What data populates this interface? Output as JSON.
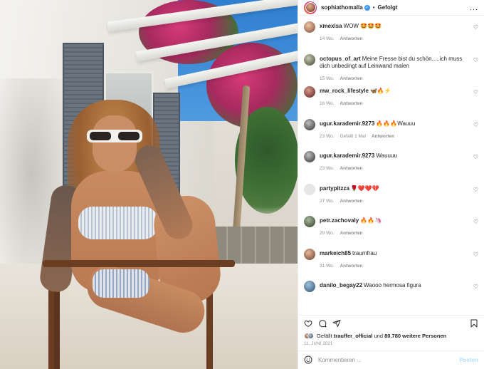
{
  "header": {
    "username": "sophiathomalla",
    "verified_icon": "verified-badge-icon",
    "separator": "•",
    "follow_status": "Gefolgt",
    "more_label": "..."
  },
  "comments": [
    {
      "user": "xmexisa",
      "text": "WOW 🤩🤩🤩",
      "time": "14 Wo.",
      "likes": "",
      "reply": "Antworten"
    },
    {
      "user": "octopus_of_art",
      "text": "Meine Fresse bist du schön.....ich muss dich unbedingt auf Leinwand malen",
      "time": "15 Wo.",
      "likes": "",
      "reply": "Antworten"
    },
    {
      "user": "mw_rock_lifestyle",
      "text": "🦋🔥⚡",
      "time": "16 Wo.",
      "likes": "",
      "reply": "Antworten"
    },
    {
      "user": "ugur.karademir.9273",
      "text": "🔥🔥🔥Wauuu",
      "time": "23 Wo.",
      "likes": "Gefällt 1 Mal",
      "reply": "Antworten"
    },
    {
      "user": "ugur.karademir.9273",
      "text": "Wauuuu",
      "time": "23 Wo.",
      "likes": "",
      "reply": "Antworten"
    },
    {
      "user": "partypitzza",
      "text": "🌹❤️❤️💔",
      "time": "27 Wo.",
      "likes": "",
      "reply": "Antworten"
    },
    {
      "user": "petr.zachovaly",
      "text": "🔥🔥🦄",
      "time": "29 Wo.",
      "likes": "",
      "reply": "Antworten"
    },
    {
      "user": "markeich85",
      "text": "traumfrau",
      "time": "31 Wo.",
      "likes": "",
      "reply": "Antworten"
    },
    {
      "user": "danilo_begay22",
      "text": "Waooo hermosa figura",
      "time": "",
      "likes": "",
      "reply": ""
    }
  ],
  "likes_line": {
    "prefix": "Gefällt",
    "user": "trauffer_official",
    "middle": "und",
    "count": "80.780 weitere Personen"
  },
  "date": "11. JUNI 2021",
  "compose": {
    "placeholder": "Kommentieren ...",
    "post_label": "Posten"
  },
  "colors": {
    "accent_blue": "#3897f0",
    "post_disabled": "#b2dffc",
    "muted": "#8e8e8e"
  }
}
